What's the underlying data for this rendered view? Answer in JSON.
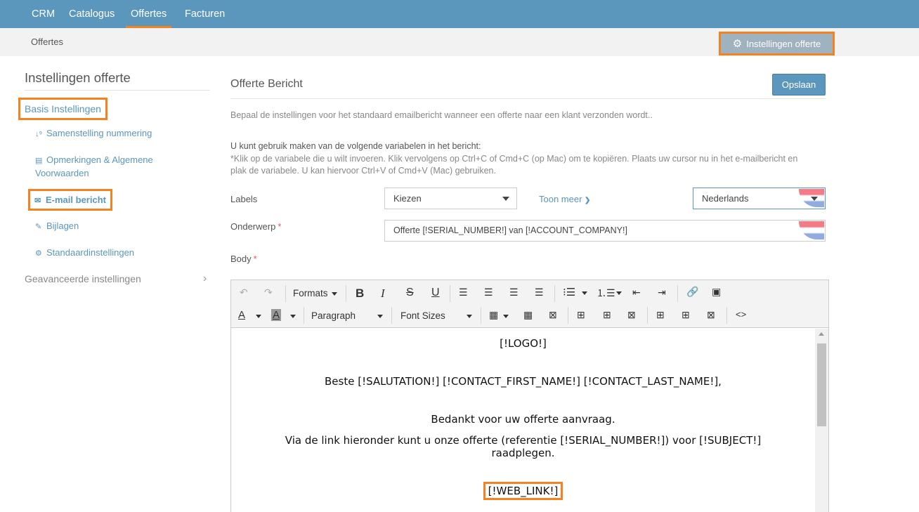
{
  "topnav": {
    "items": [
      {
        "label": "CRM"
      },
      {
        "label": "Catalogus"
      },
      {
        "label": "Offertes"
      },
      {
        "label": "Facturen"
      }
    ]
  },
  "subbar": {
    "breadcrumb": "Offertes",
    "settings_button": "Instellingen offerte"
  },
  "sidebar": {
    "title": "Instellingen offerte",
    "basis": "Basis Instellingen",
    "items": [
      {
        "label": "Samenstelling nummering",
        "icon": "sort-numeric-icon"
      },
      {
        "label": "Opmerkingen & Algemene Voorwaarden",
        "icon": "document-icon"
      },
      {
        "label": "E-mail bericht",
        "icon": "envelope-icon"
      },
      {
        "label": "Bijlagen",
        "icon": "paperclip-icon"
      },
      {
        "label": "Standaardinstellingen",
        "icon": "gear-icon"
      }
    ],
    "advanced": "Geavanceerde instellingen"
  },
  "main": {
    "title": "Offerte Bericht",
    "save_button": "Opslaan",
    "description": "Bepaal de instellingen voor het standaard emailbericht wanneer een offerte naar een klant verzonden wordt..",
    "vars_intro": "U kunt gebruik maken van de volgende variabelen in het bericht:",
    "vars_help": "*Klik op de variabele die u wilt invoeren. Klik vervolgens op Ctrl+C of Cmd+C (op Mac) om te kopiëren. Plaats uw cursor nu in het e-mailbericht en plak de variabele. U kan hiervoor Ctrl+V of Cmd+V (Mac) gebruiken.",
    "labels_label": "Labels",
    "labels_select": "Kiezen",
    "toon_meer": "Toon meer",
    "language_select": "Nederlands",
    "subject_label": "Onderwerp",
    "subject_value": "Offerte  [!SERIAL_NUMBER!] van [!ACCOUNT_COMPANY!]",
    "body_label": "Body",
    "required_mark": "*"
  },
  "editor": {
    "formats": "Formats",
    "paragraph": "Paragraph",
    "font_sizes": "Font Sizes",
    "content": {
      "logo": "[!LOGO!]",
      "greeting": "Beste [!SALUTATION!] [!CONTACT_FIRST_NAME!] [!CONTACT_LAST_NAME!],",
      "thanks": "Bedankt voor uw offerte aanvraag.",
      "via_line1": "Via de link hieronder kunt u onze offerte (referentie [!SERIAL_NUMBER!]) voor [!SUBJECT!]",
      "via_line2": "raadplegen.",
      "web_link": "[!WEB_LINK!]"
    }
  },
  "colors": {
    "nav_bg": "#5b96bd",
    "highlight": "#f58220",
    "link": "#5b96bd"
  }
}
